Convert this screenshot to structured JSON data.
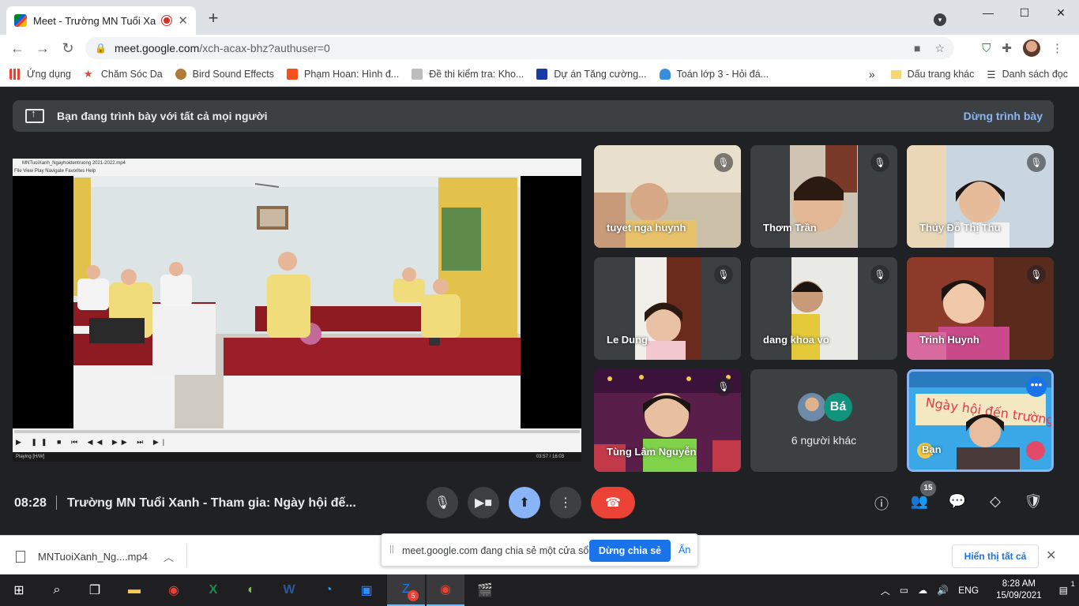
{
  "browser": {
    "tab_title": "Meet - Trường MN Tuổi Xanh",
    "tab_close": "✕",
    "new_tab": "+",
    "url_host": "meet.google.com",
    "url_path": "/xch-acax-bhz?authuser=0",
    "win_minimize": "—",
    "win_maximize": "☐",
    "win_close": "✕"
  },
  "bookmarks": {
    "items": [
      {
        "label": "Ứng dụng",
        "color": "#e94235"
      },
      {
        "label": "Chăm Sóc Da",
        "color": "#e94235"
      },
      {
        "label": "Bird Sound Effects",
        "color": "#b07a3a"
      },
      {
        "label": "Phạm Hoan: Hình đ...",
        "color": "#f4511e"
      },
      {
        "label": "Đề thi kiểm tra: Kho...",
        "color": "#888888"
      },
      {
        "label": "Dự án Tăng cường...",
        "color": "#1a3aa8"
      },
      {
        "label": "Toán lớp 3 - Hỏi đá...",
        "color": "#3b8de0"
      }
    ],
    "overflow": "»",
    "other_folder": "Dấu trang khác",
    "reading_list": "Danh sách đọc"
  },
  "meet": {
    "banner_text": "Bạn đang trình bày với tất cả mọi người",
    "stop_presenting": "Dừng trình bày",
    "player": {
      "title": "MNTuoiXanh_Ngayhoidentruong 2021-2022.mp4",
      "menu": "File    View    Play    Navigate    Favorites    Help",
      "status_left": "Playing [H/W]",
      "status_right": "03:57 / 16:03"
    },
    "participants": [
      {
        "name": "tuyet nga huynh"
      },
      {
        "name": "Thơm Trần"
      },
      {
        "name": "Thủy Đỗ Thị Thu"
      },
      {
        "name": "Le Dung"
      },
      {
        "name": "dang khoa vo"
      },
      {
        "name": "Trinh Huynh"
      },
      {
        "name": "Tùng Lâm Nguyễn"
      }
    ],
    "others_avatar_letter": "Bá",
    "others_label": "6 người khác",
    "self_label": "Bạn",
    "clock": "08:28",
    "meeting_title": "Trường MN Tuổi Xanh - Tham gia: Ngày hội đế...",
    "people_count": "15"
  },
  "downloads": {
    "file": "MNTuoiXanh_Ng....mp4",
    "show_all": "Hiển thị tất cả"
  },
  "share_popup": {
    "grip": "||",
    "message": "meet.google.com đang chia sẻ một cửa sổ.",
    "stop_button": "Dừng chia sẻ",
    "hide_button": "Ẩn"
  },
  "taskbar": {
    "chrome_badge": "5",
    "language": "ENG",
    "time": "8:28 AM",
    "date": "15/09/2021",
    "notif_count": "1"
  }
}
